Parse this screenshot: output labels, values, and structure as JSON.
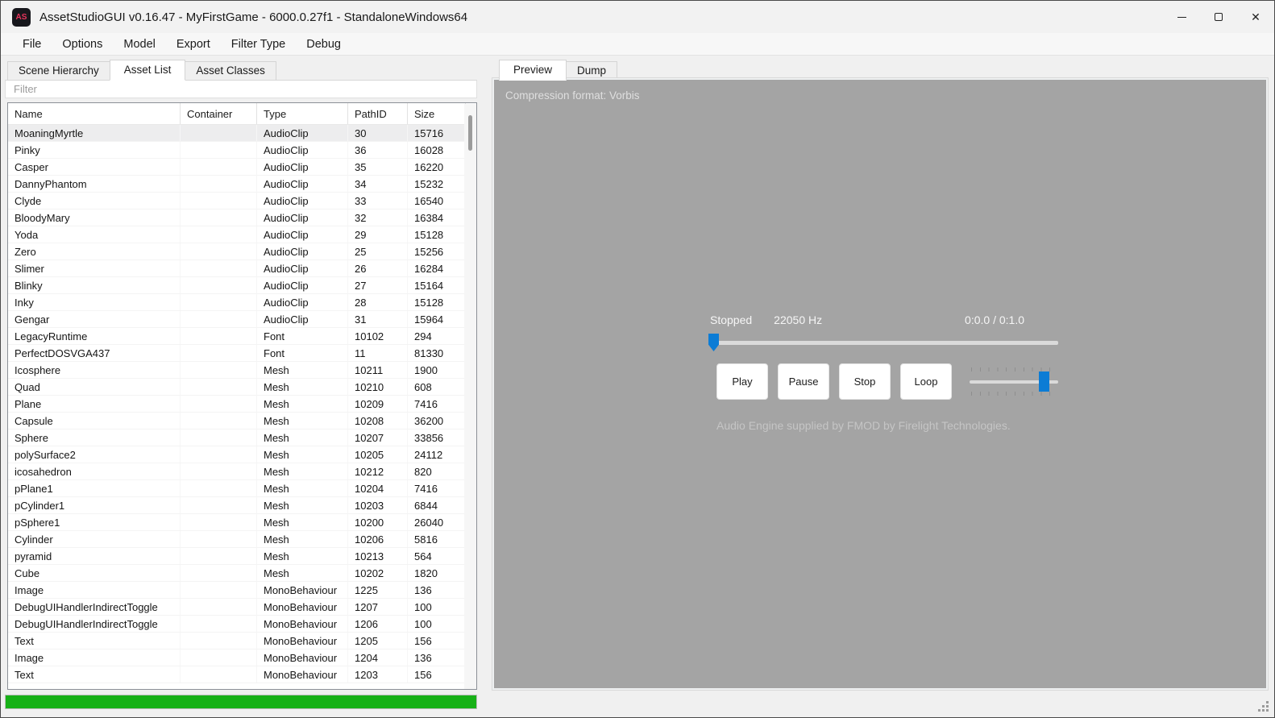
{
  "window": {
    "title": "AssetStudioGUI v0.16.47 - MyFirstGame - 6000.0.27f1 - StandaloneWindows64",
    "icon_text": "AS"
  },
  "menu": {
    "items": [
      "File",
      "Options",
      "Model",
      "Export",
      "Filter Type",
      "Debug"
    ]
  },
  "left_panel": {
    "tabs": [
      "Scene Hierarchy",
      "Asset List",
      "Asset Classes"
    ],
    "selected_tab": "Asset List",
    "filter_placeholder": "Filter",
    "table": {
      "columns": [
        "Name",
        "Container",
        "Type",
        "PathID",
        "Size"
      ],
      "selected_index": 0,
      "rows": [
        {
          "name": "MoaningMyrtle",
          "container": "",
          "type": "AudioClip",
          "path_id": "30",
          "size": "15716"
        },
        {
          "name": "Pinky",
          "container": "",
          "type": "AudioClip",
          "path_id": "36",
          "size": "16028"
        },
        {
          "name": "Casper",
          "container": "",
          "type": "AudioClip",
          "path_id": "35",
          "size": "16220"
        },
        {
          "name": "DannyPhantom",
          "container": "",
          "type": "AudioClip",
          "path_id": "34",
          "size": "15232"
        },
        {
          "name": "Clyde",
          "container": "",
          "type": "AudioClip",
          "path_id": "33",
          "size": "16540"
        },
        {
          "name": "BloodyMary",
          "container": "",
          "type": "AudioClip",
          "path_id": "32",
          "size": "16384"
        },
        {
          "name": "Yoda",
          "container": "",
          "type": "AudioClip",
          "path_id": "29",
          "size": "15128"
        },
        {
          "name": "Zero",
          "container": "",
          "type": "AudioClip",
          "path_id": "25",
          "size": "15256"
        },
        {
          "name": "Slimer",
          "container": "",
          "type": "AudioClip",
          "path_id": "26",
          "size": "16284"
        },
        {
          "name": "Blinky",
          "container": "",
          "type": "AudioClip",
          "path_id": "27",
          "size": "15164"
        },
        {
          "name": "Inky",
          "container": "",
          "type": "AudioClip",
          "path_id": "28",
          "size": "15128"
        },
        {
          "name": "Gengar",
          "container": "",
          "type": "AudioClip",
          "path_id": "31",
          "size": "15964"
        },
        {
          "name": "LegacyRuntime",
          "container": "",
          "type": "Font",
          "path_id": "10102",
          "size": "294"
        },
        {
          "name": "PerfectDOSVGA437",
          "container": "",
          "type": "Font",
          "path_id": "11",
          "size": "81330"
        },
        {
          "name": "Icosphere",
          "container": "",
          "type": "Mesh",
          "path_id": "10211",
          "size": "1900"
        },
        {
          "name": "Quad",
          "container": "",
          "type": "Mesh",
          "path_id": "10210",
          "size": "608"
        },
        {
          "name": "Plane",
          "container": "",
          "type": "Mesh",
          "path_id": "10209",
          "size": "7416"
        },
        {
          "name": "Capsule",
          "container": "",
          "type": "Mesh",
          "path_id": "10208",
          "size": "36200"
        },
        {
          "name": "Sphere",
          "container": "",
          "type": "Mesh",
          "path_id": "10207",
          "size": "33856"
        },
        {
          "name": "polySurface2",
          "container": "",
          "type": "Mesh",
          "path_id": "10205",
          "size": "24112"
        },
        {
          "name": "icosahedron",
          "container": "",
          "type": "Mesh",
          "path_id": "10212",
          "size": "820"
        },
        {
          "name": "pPlane1",
          "container": "",
          "type": "Mesh",
          "path_id": "10204",
          "size": "7416"
        },
        {
          "name": "pCylinder1",
          "container": "",
          "type": "Mesh",
          "path_id": "10203",
          "size": "6844"
        },
        {
          "name": "pSphere1",
          "container": "",
          "type": "Mesh",
          "path_id": "10200",
          "size": "26040"
        },
        {
          "name": "Cylinder",
          "container": "",
          "type": "Mesh",
          "path_id": "10206",
          "size": "5816"
        },
        {
          "name": "pyramid",
          "container": "",
          "type": "Mesh",
          "path_id": "10213",
          "size": "564"
        },
        {
          "name": "Cube",
          "container": "",
          "type": "Mesh",
          "path_id": "10202",
          "size": "1820"
        },
        {
          "name": "Image",
          "container": "",
          "type": "MonoBehaviour",
          "path_id": "1225",
          "size": "136"
        },
        {
          "name": "DebugUIHandlerIndirectToggle",
          "container": "",
          "type": "MonoBehaviour",
          "path_id": "1207",
          "size": "100"
        },
        {
          "name": "DebugUIHandlerIndirectToggle",
          "container": "",
          "type": "MonoBehaviour",
          "path_id": "1206",
          "size": "100"
        },
        {
          "name": "Text",
          "container": "",
          "type": "MonoBehaviour",
          "path_id": "1205",
          "size": "156"
        },
        {
          "name": "Image",
          "container": "",
          "type": "MonoBehaviour",
          "path_id": "1204",
          "size": "136"
        },
        {
          "name": "Text",
          "container": "",
          "type": "MonoBehaviour",
          "path_id": "1203",
          "size": "156"
        }
      ]
    },
    "progress_percent": 100
  },
  "right_panel": {
    "tabs": [
      "Preview",
      "Dump"
    ],
    "selected_tab": "Preview",
    "preview": {
      "info_label": "Compression format: Vorbis",
      "player": {
        "status": "Stopped",
        "sample_rate": "22050 Hz",
        "time": "0:0.0 / 0:1.0",
        "progress_percent": 0,
        "volume_percent": 78,
        "buttons": [
          "Play",
          "Pause",
          "Stop",
          "Loop"
        ],
        "fmod_credit": "Audio Engine supplied by FMOD by Firelight Technologies."
      }
    }
  },
  "colors": {
    "accent": "#0c7cd5",
    "progress_green": "#17b117",
    "preview_bg": "#a4a4a4"
  }
}
